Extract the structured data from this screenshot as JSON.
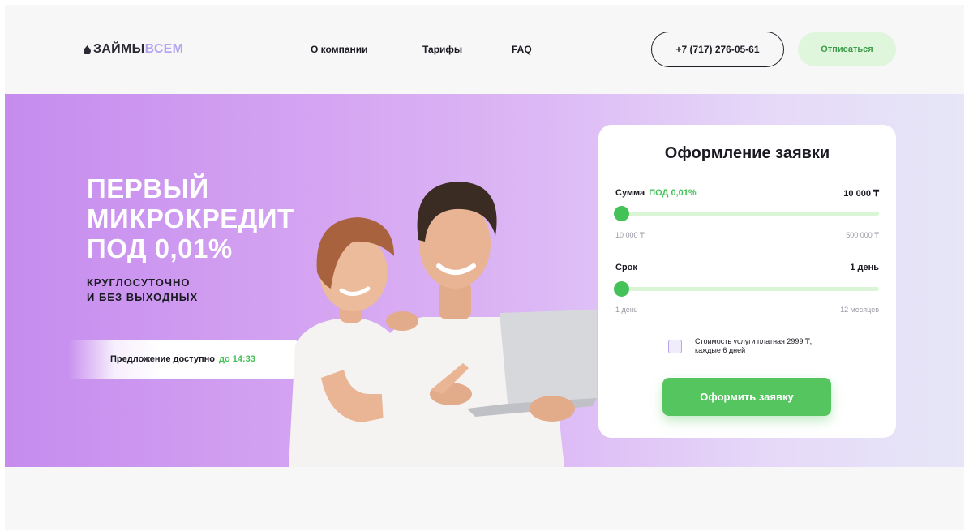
{
  "header": {
    "logo_part1": "ЗАЙМЫ",
    "logo_part2": "ВСЕМ",
    "nav": [
      "О компании",
      "Тарифы",
      "FAQ"
    ],
    "phone": "+7 (717) 276-05-61",
    "unsubscribe": "Отписаться"
  },
  "hero": {
    "title": "ПЕРВЫЙ МИКРОКРЕДИТ ПОД 0,01%",
    "subtitle_line1": "КРУГЛОСУТОЧНО",
    "subtitle_line2": "И БЕЗ ВЫХОДНЫХ",
    "offer_text": "Предложение доступно",
    "offer_time": "до 14:33"
  },
  "form": {
    "title": "Оформление заявки",
    "amount": {
      "label": "Сумма",
      "label_accent": "ПОД 0,01%",
      "value": "10 000 ₸",
      "min": "10 000 ₸",
      "max": "500 000 ₸",
      "level": 0
    },
    "term": {
      "label": "Срок",
      "value": "1 день",
      "min": "1 день",
      "max": "12 месяцев",
      "level": 0
    },
    "checkbox_text": "Стоимость услуги платная 2999 ₸, каждые 6 дней",
    "checkbox_checked": false,
    "submit": "Оформить заявку"
  },
  "colors": {
    "accent_green": "#45c257",
    "hero_purple": "#c58cee",
    "logo_lilac": "#b7a5f0"
  }
}
